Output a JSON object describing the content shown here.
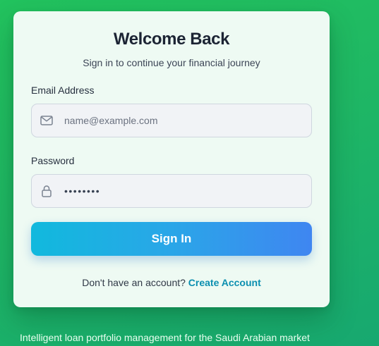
{
  "login": {
    "title": "Welcome Back",
    "subtitle": "Sign in to continue your financial journey",
    "email_label": "Email Address",
    "email_placeholder": "name@example.com",
    "email_value": "",
    "email_icon": "mail-icon",
    "password_label": "Password",
    "password_value": "••••••••",
    "password_icon": "lock-icon",
    "sign_in_label": "Sign In",
    "no_account_text": "Don't have an account?",
    "create_account_label": "Create Account"
  },
  "footer": {
    "tagline": "Intelligent loan portfolio management for the Saudi Arabian market"
  },
  "colors": {
    "background": "#22c35e",
    "card": "#eefaf3",
    "title": "#1c2434",
    "button_start": "#11b9dd",
    "button_end": "#3f86f1",
    "link": "#0b8fb0"
  }
}
